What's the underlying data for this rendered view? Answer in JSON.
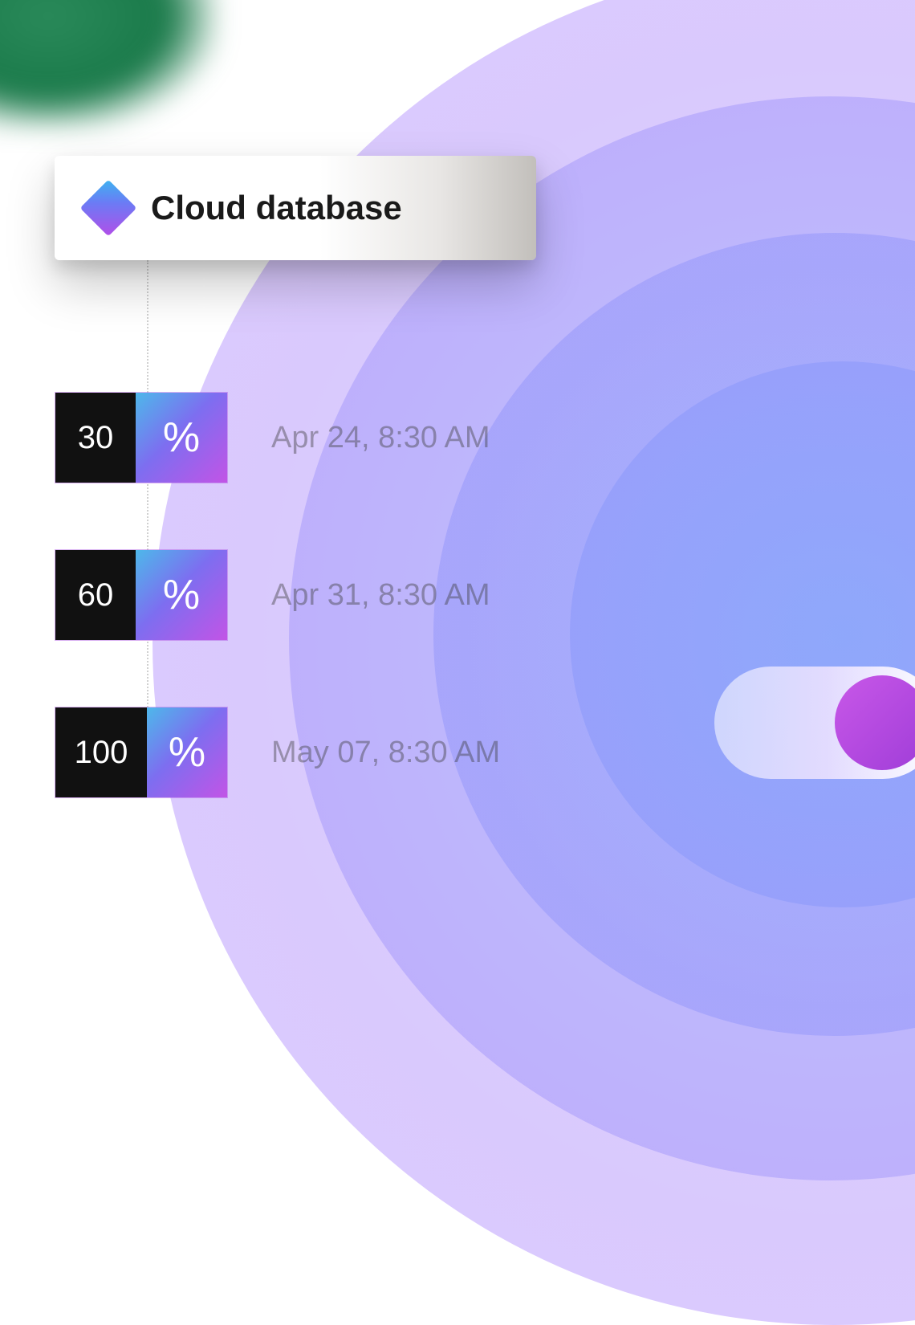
{
  "card": {
    "title": "Cloud database",
    "icon": "diamond-icon"
  },
  "entries": [
    {
      "value": "30",
      "symbol": "%",
      "timestamp": "Apr 24, 8:30 AM"
    },
    {
      "value": "60",
      "symbol": "%",
      "timestamp": "Apr 31, 8:30 AM"
    },
    {
      "value": "100",
      "symbol": "%",
      "timestamp": "May 07, 8:30 AM"
    }
  ],
  "toggle": {
    "state": "on"
  },
  "colors": {
    "accent_gradient_start": "#3db4f0",
    "accent_gradient_mid": "#6a7cf5",
    "accent_gradient_end": "#b24ee8",
    "dark": "#111111"
  }
}
